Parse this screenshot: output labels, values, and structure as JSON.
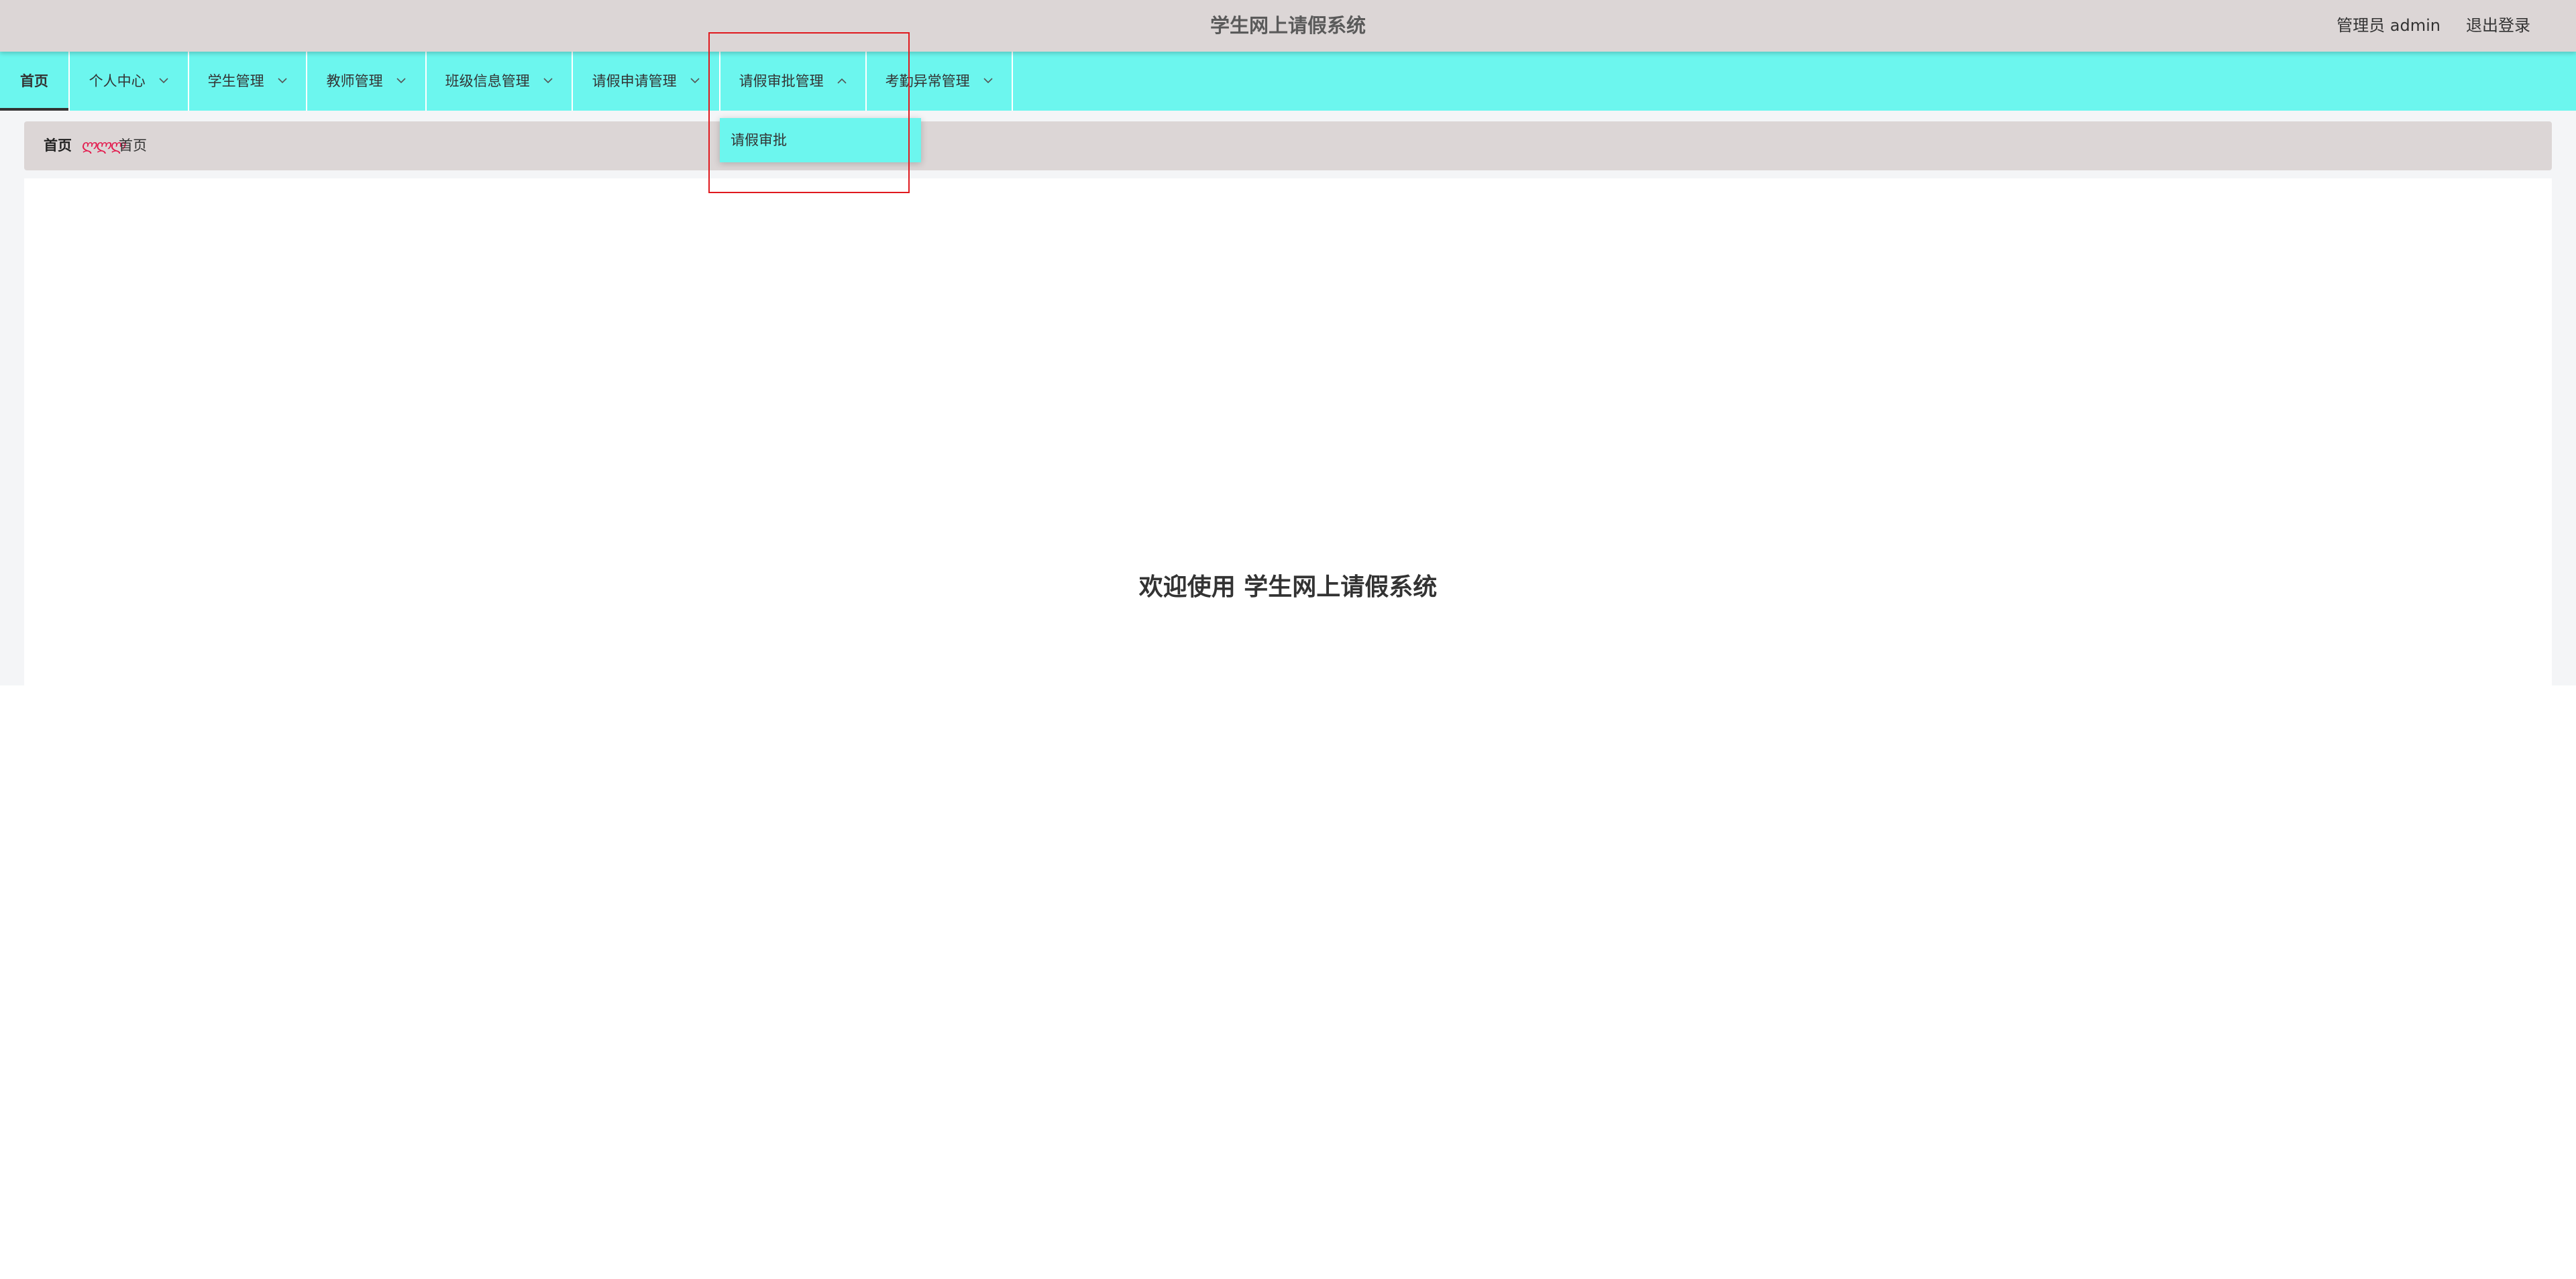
{
  "header": {
    "title": "学生网上请假系统",
    "user_info": "管理员 admin",
    "logout_label": "退出登录"
  },
  "nav": {
    "items": [
      {
        "label": "首页",
        "has_chevron": false
      },
      {
        "label": "个人中心",
        "has_chevron": true
      },
      {
        "label": "学生管理",
        "has_chevron": true
      },
      {
        "label": "教师管理",
        "has_chevron": true
      },
      {
        "label": "班级信息管理",
        "has_chevron": true
      },
      {
        "label": "请假申请管理",
        "has_chevron": true
      },
      {
        "label": "请假审批管理",
        "has_chevron": true,
        "expanded": true
      },
      {
        "label": "考勤异常管理",
        "has_chevron": true
      }
    ],
    "dropdown": {
      "items": [
        "请假审批"
      ]
    },
    "accent_color": "#6cf6ee"
  },
  "breadcrumb": {
    "home": "首页",
    "separator": "ლლლ",
    "current": "首页"
  },
  "main": {
    "welcome_text": "欢迎使用 学生网上请假系统"
  },
  "colors": {
    "header_bg": "#dcd6d6",
    "nav_bg": "#6cf6ee",
    "highlight": "#e0191e",
    "breadcrumb_sep": "#e31a4d"
  }
}
